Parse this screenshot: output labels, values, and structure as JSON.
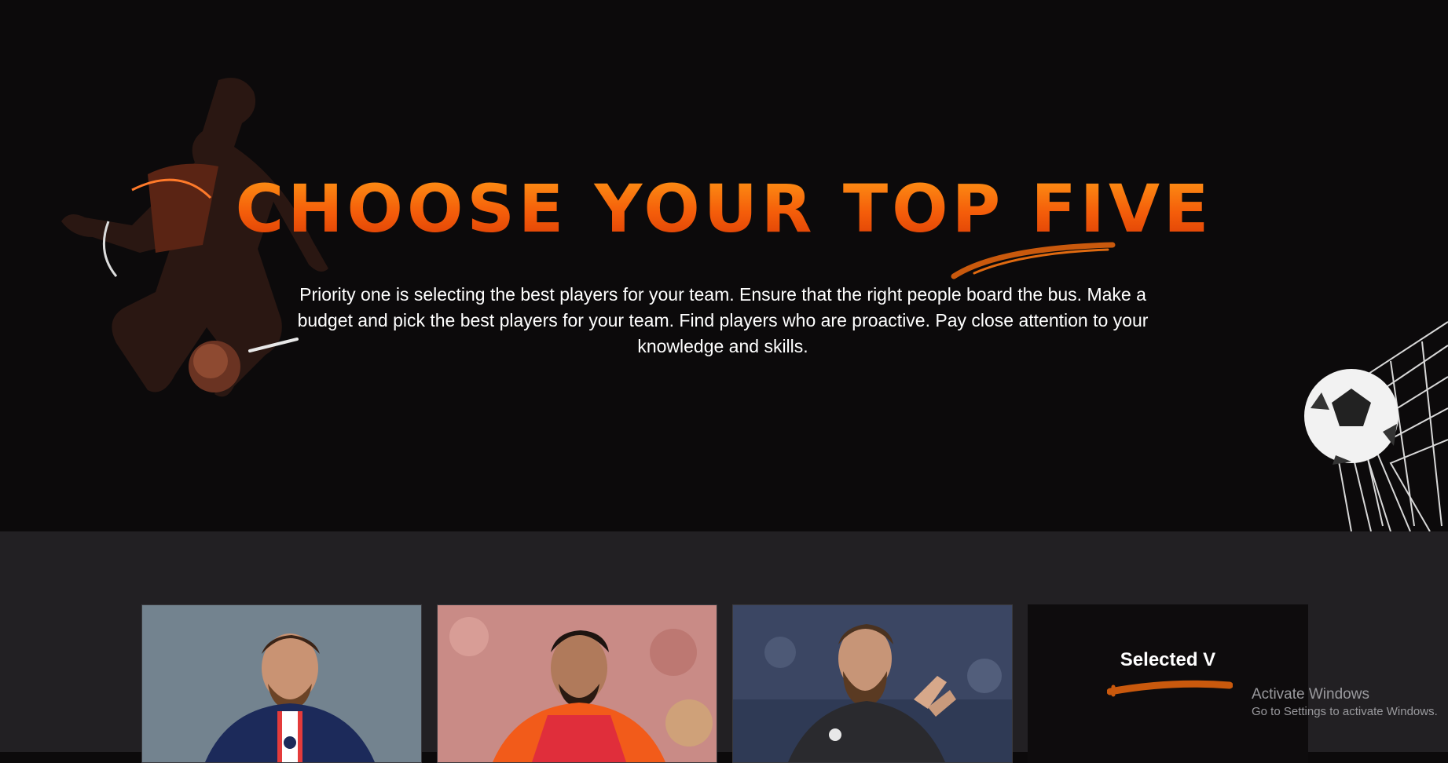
{
  "hero": {
    "title": "CHOOSE YOUR TOP FIVE",
    "description": "Priority one is selecting the best players for your team. Ensure that the right people board the bus. Make a budget and pick the best players for your team. Find players who are proactive. Pay close attention to your knowledge and skills.",
    "accent_color": "#f45d0a"
  },
  "cards": [
    {
      "id": "player-card-1",
      "image": "player-photo",
      "kit_color": "#1c2a5a",
      "background": "#7f8f9c"
    },
    {
      "id": "player-card-2",
      "image": "player-photo",
      "kit_color": "#f25b1a",
      "background": "#c98b86"
    },
    {
      "id": "player-card-3",
      "image": "player-photo",
      "kit_color": "#2a2a2e",
      "background": "#3b4663"
    },
    {
      "id": "player-card-4",
      "selected_label": "Selected V"
    }
  ],
  "system_watermark": {
    "line1": "Activate Windows",
    "line2": "Go to Settings to activate Windows."
  }
}
